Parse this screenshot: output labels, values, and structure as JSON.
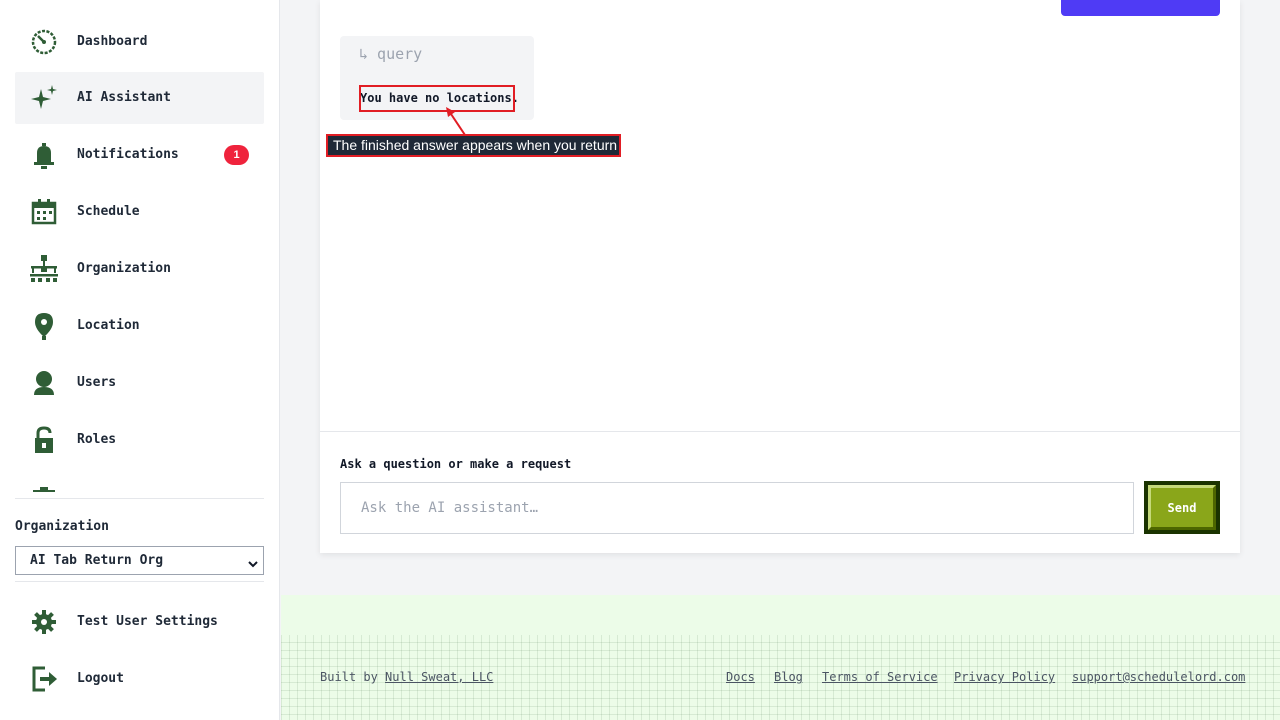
{
  "sidebar": {
    "items": [
      {
        "label": "Dashboard",
        "icon": "dashboard-icon"
      },
      {
        "label": "AI Assistant",
        "icon": "sparkle-icon",
        "active": true
      },
      {
        "label": "Notifications",
        "icon": "bell-icon",
        "badge": "1"
      },
      {
        "label": "Schedule",
        "icon": "calendar-icon"
      },
      {
        "label": "Organization",
        "icon": "org-chart-icon"
      },
      {
        "label": "Location",
        "icon": "location-pin-icon"
      },
      {
        "label": "Users",
        "icon": "user-icon"
      },
      {
        "label": "Roles",
        "icon": "unlock-icon"
      }
    ],
    "organization": {
      "label": "Organization",
      "selected": "AI Tab Return Org"
    },
    "bottom_items": [
      {
        "label": "Test User Settings",
        "icon": "gear-icon"
      },
      {
        "label": "Logout",
        "icon": "logout-icon"
      }
    ]
  },
  "chat": {
    "message": {
      "kind": "↳ query",
      "text": "You have no locations."
    },
    "composer": {
      "label": "Ask a question or make a request",
      "placeholder": "Ask the AI assistant…",
      "send_label": "Send"
    }
  },
  "annotation": {
    "text": "The finished answer appears when you return"
  },
  "footer": {
    "built_by_prefix": "Built by",
    "built_by_link": "Null Sweat, LLC",
    "links": [
      "Docs",
      "Blog",
      "Terms of Service",
      "Privacy Policy",
      "support@schedulelord.com"
    ]
  },
  "colors": {
    "icon_green": "#2f5d36",
    "accent_purple": "#4f3bf5",
    "send_green": "#8aa61a",
    "badge_red": "#ef233c",
    "annotation_red": "#e11d24"
  }
}
